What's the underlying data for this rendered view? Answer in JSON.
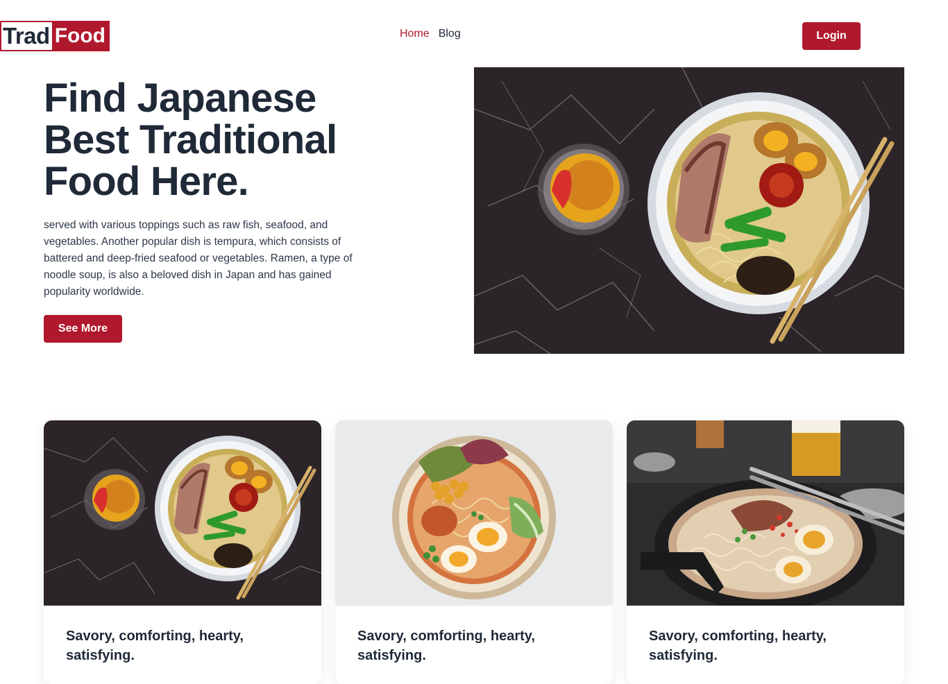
{
  "header": {
    "logo": {
      "part1": "Trad",
      "part2": "Food"
    },
    "nav": [
      {
        "label": "Home",
        "active": true
      },
      {
        "label": "Blog",
        "active": false
      }
    ],
    "login_label": "Login"
  },
  "hero": {
    "title": "Find Japanese Best Traditional Food Here.",
    "description": "served with various toppings such as raw fish, seafood, and vegetables. Another popular dish is tempura, which consists of battered and deep-fried seafood or vegetables. Ramen, a type of noodle soup, is also a beloved dish in Japan and has gained popularity worldwide.",
    "cta_label": "See More"
  },
  "cards": [
    {
      "title": "Savory, comforting, hearty, satisfying."
    },
    {
      "title": "Savory, comforting, hearty, satisfying."
    },
    {
      "title": "Savory, comforting, hearty, satisfying."
    }
  ],
  "colors": {
    "brand": "#b0182d",
    "text": "#1f2937",
    "background": "#ffffff"
  }
}
